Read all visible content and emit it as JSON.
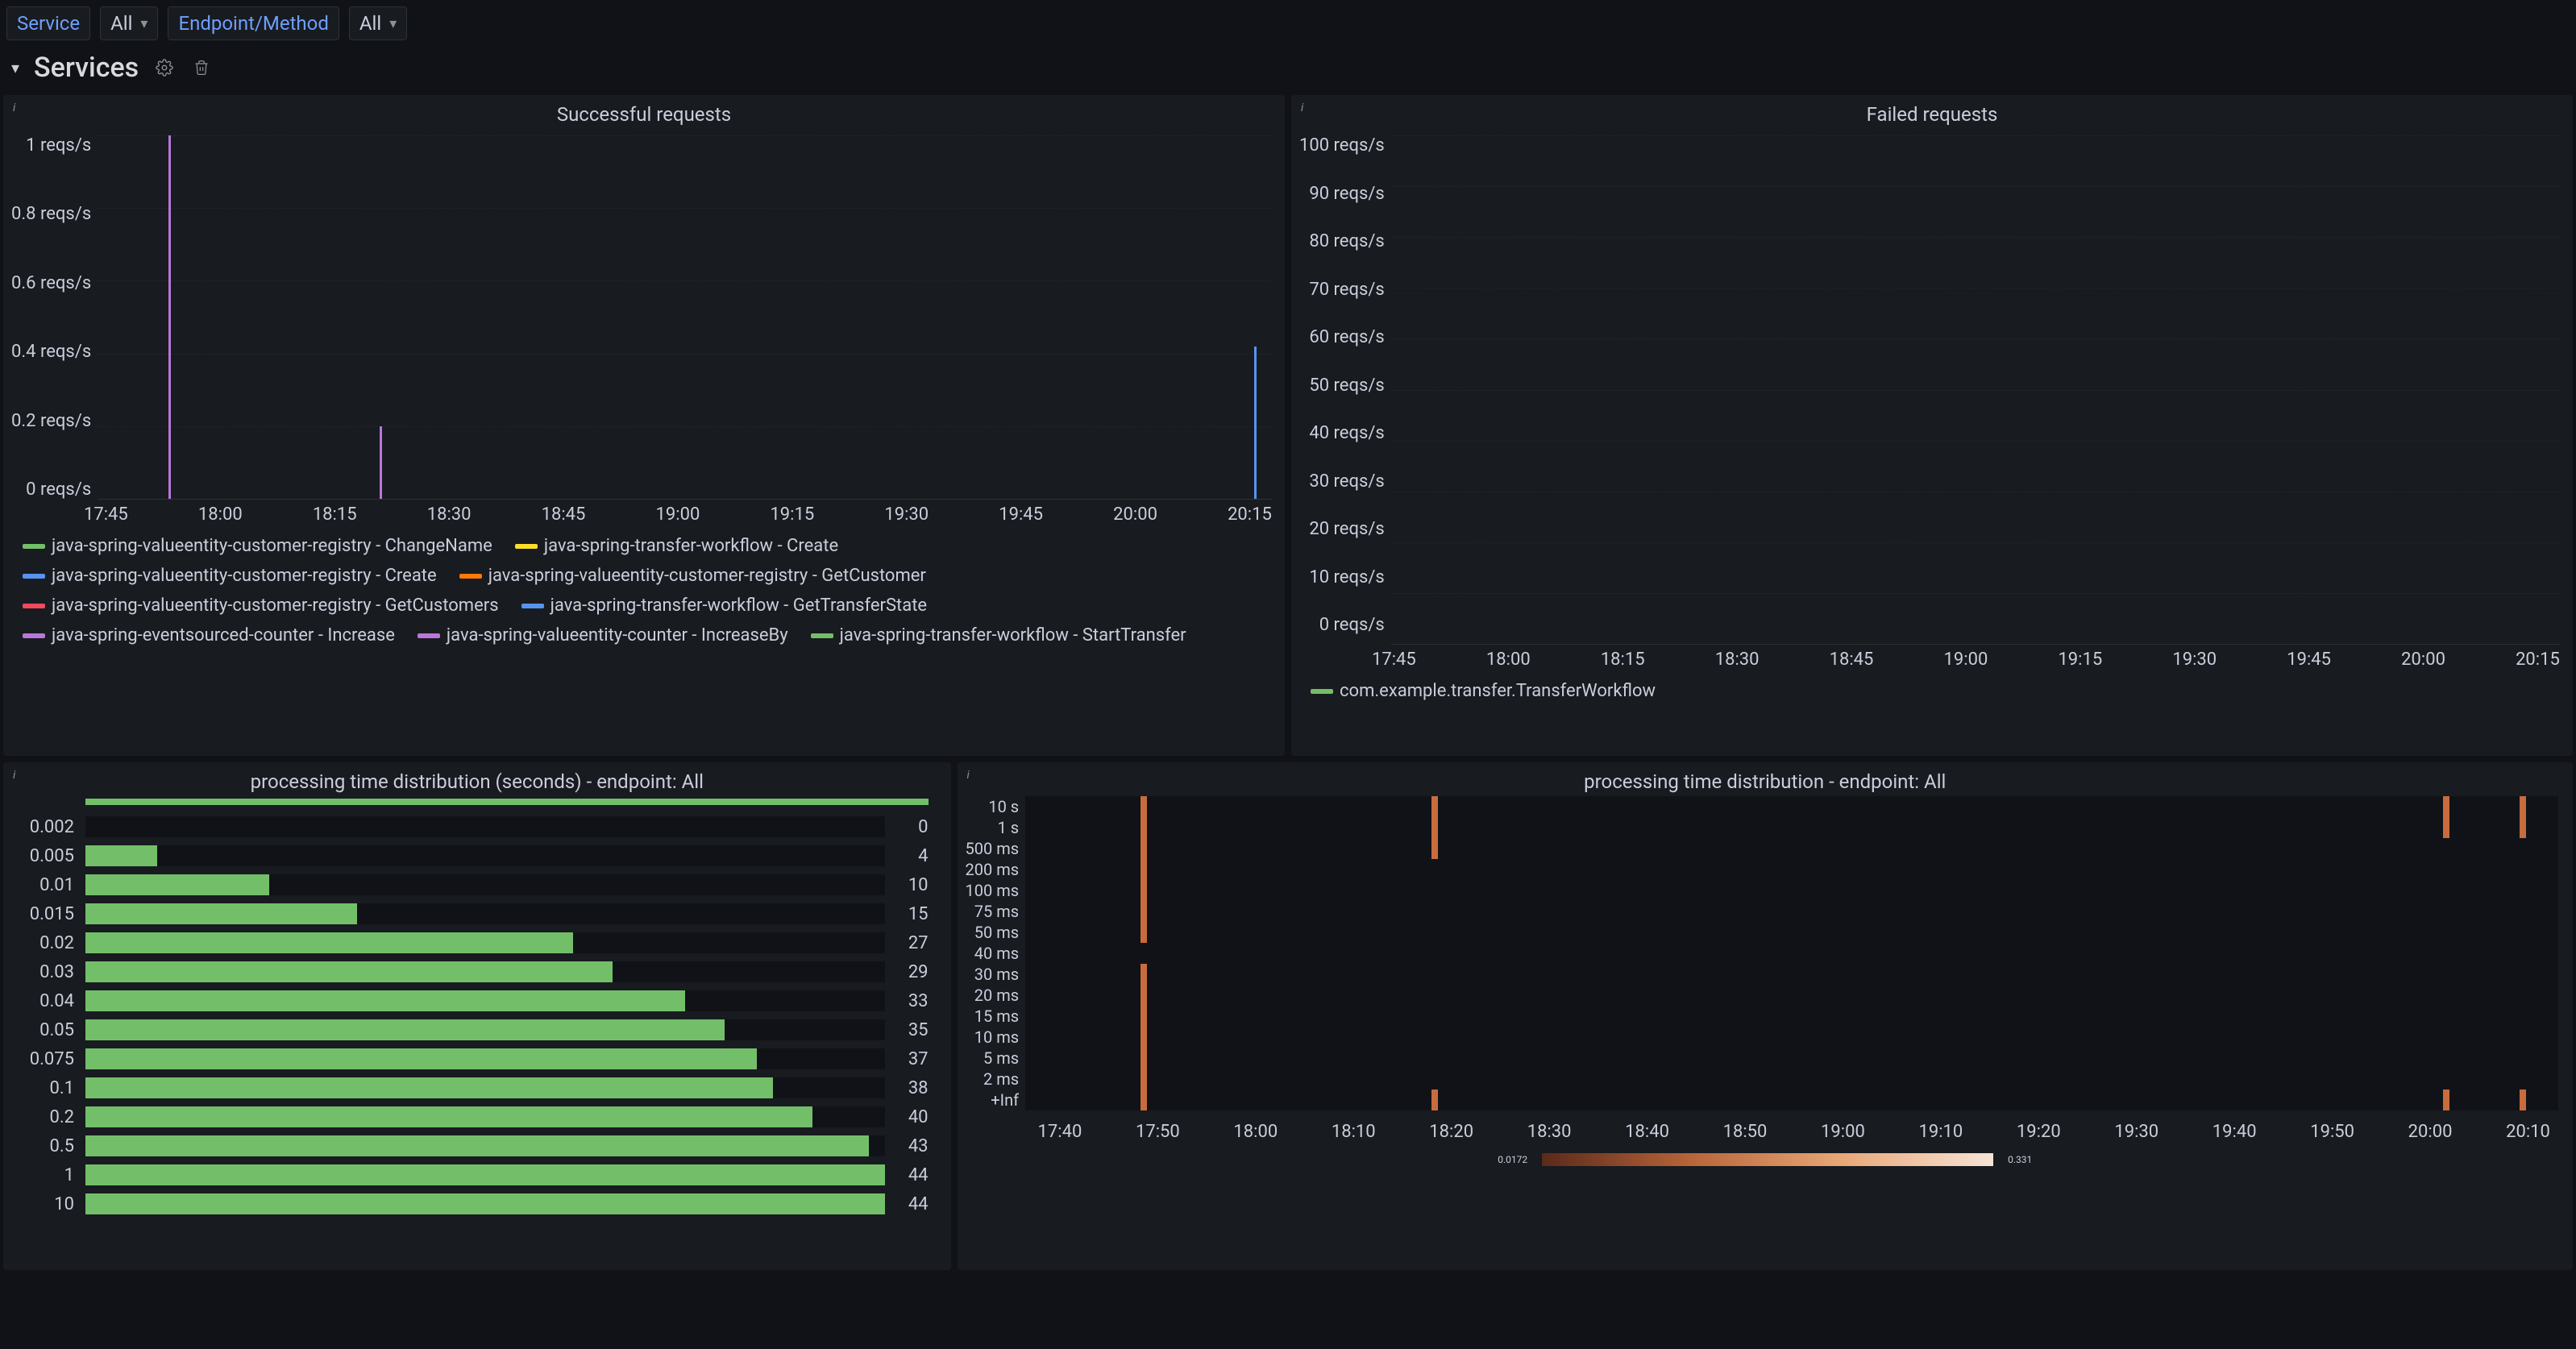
{
  "toolbar": {
    "service_label": "Service",
    "service_value": "All",
    "endpoint_label": "Endpoint/Method",
    "endpoint_value": "All"
  },
  "section_title": "Services",
  "panel_successful": {
    "title": "Successful requests",
    "y_ticks": [
      "1 reqs/s",
      "0.8 reqs/s",
      "0.6 reqs/s",
      "0.4 reqs/s",
      "0.2 reqs/s",
      "0 reqs/s"
    ],
    "x_ticks": [
      "17:45",
      "18:00",
      "18:15",
      "18:30",
      "18:45",
      "19:00",
      "19:15",
      "19:30",
      "19:45",
      "20:00",
      "20:15"
    ],
    "legend": [
      {
        "color": "#73bf69",
        "label": "java-spring-valueentity-customer-registry - ChangeName"
      },
      {
        "color": "#fade2a",
        "label": "java-spring-transfer-workflow - Create"
      },
      {
        "color": "#5794f2",
        "label": "java-spring-valueentity-customer-registry - Create"
      },
      {
        "color": "#ff780a",
        "label": "java-spring-valueentity-customer-registry - GetCustomer"
      },
      {
        "color": "#f2495c",
        "label": "java-spring-valueentity-customer-registry - GetCustomers"
      },
      {
        "color": "#5794f2",
        "label": "java-spring-transfer-workflow - GetTransferState"
      },
      {
        "color": "#b877d9",
        "label": "java-spring-eventsourced-counter - Increase"
      },
      {
        "color": "#b877d9",
        "label": "java-spring-valueentity-counter - IncreaseBy"
      },
      {
        "color": "#73bf69",
        "label": "java-spring-transfer-workflow - StartTransfer"
      }
    ]
  },
  "panel_failed": {
    "title": "Failed requests",
    "y_ticks": [
      "100 reqs/s",
      "90 reqs/s",
      "80 reqs/s",
      "70 reqs/s",
      "60 reqs/s",
      "50 reqs/s",
      "40 reqs/s",
      "30 reqs/s",
      "20 reqs/s",
      "10 reqs/s",
      "0 reqs/s"
    ],
    "x_ticks": [
      "17:45",
      "18:00",
      "18:15",
      "18:30",
      "18:45",
      "19:00",
      "19:15",
      "19:30",
      "19:45",
      "20:00",
      "20:15"
    ],
    "legend": [
      {
        "color": "#73bf69",
        "label": "com.example.transfer.TransferWorkflow"
      }
    ]
  },
  "panel_hist": {
    "title": "processing time distribution (seconds) - endpoint: All",
    "rows": [
      {
        "bucket": "0.002",
        "count": 0,
        "frac": 0.0
      },
      {
        "bucket": "0.005",
        "count": 4,
        "frac": 0.09
      },
      {
        "bucket": "0.01",
        "count": 10,
        "frac": 0.23
      },
      {
        "bucket": "0.015",
        "count": 15,
        "frac": 0.34
      },
      {
        "bucket": "0.02",
        "count": 27,
        "frac": 0.61
      },
      {
        "bucket": "0.03",
        "count": 29,
        "frac": 0.66
      },
      {
        "bucket": "0.04",
        "count": 33,
        "frac": 0.75
      },
      {
        "bucket": "0.05",
        "count": 35,
        "frac": 0.8
      },
      {
        "bucket": "0.075",
        "count": 37,
        "frac": 0.84
      },
      {
        "bucket": "0.1",
        "count": 38,
        "frac": 0.86
      },
      {
        "bucket": "0.2",
        "count": 40,
        "frac": 0.91
      },
      {
        "bucket": "0.5",
        "count": 43,
        "frac": 0.98
      },
      {
        "bucket": "1",
        "count": 44,
        "frac": 1.0
      },
      {
        "bucket": "10",
        "count": 44,
        "frac": 1.0
      }
    ]
  },
  "panel_heat": {
    "title": "processing time distribution - endpoint: All",
    "y_ticks": [
      "10 s",
      "1 s",
      "500 ms",
      "200 ms",
      "100 ms",
      "75 ms",
      "50 ms",
      "40 ms",
      "30 ms",
      "20 ms",
      "15 ms",
      "10 ms",
      "5 ms",
      "2 ms",
      "+Inf"
    ],
    "x_ticks": [
      "17:40",
      "17:50",
      "18:00",
      "18:10",
      "18:20",
      "18:30",
      "18:40",
      "18:50",
      "19:00",
      "19:10",
      "19:20",
      "19:30",
      "19:40",
      "19:50",
      "20:00",
      "20:10"
    ],
    "scale_min": "0.0172",
    "scale_max": "0.331",
    "columns": [
      {
        "x_frac": 0.075,
        "cells": [
          1,
          1,
          1,
          1,
          1,
          1,
          1,
          0,
          1,
          1,
          1,
          1,
          1,
          1,
          1
        ]
      },
      {
        "x_frac": 0.265,
        "cells": [
          1,
          0,
          0,
          0,
          0,
          0,
          0,
          0,
          0,
          0,
          0,
          0,
          1,
          1,
          1
        ]
      },
      {
        "x_frac": 0.925,
        "cells": [
          1,
          0,
          0,
          0,
          0,
          0,
          0,
          0,
          0,
          0,
          0,
          0,
          0,
          1,
          1
        ]
      },
      {
        "x_frac": 0.975,
        "cells": [
          1,
          0,
          0,
          0,
          0,
          0,
          0,
          0,
          0,
          0,
          0,
          0,
          0,
          1,
          1
        ]
      }
    ]
  },
  "chart_data": [
    {
      "type": "line",
      "title": "Successful requests",
      "xlabel": "",
      "ylabel": "reqs/s",
      "ylim": [
        0,
        1
      ],
      "x": [
        "17:45",
        "18:00",
        "18:15",
        "18:30",
        "18:45",
        "19:00",
        "19:15",
        "19:30",
        "19:45",
        "20:00",
        "20:15"
      ],
      "series": [
        {
          "name": "java-spring-valueentity-customer-registry - ChangeName",
          "spikes": []
        },
        {
          "name": "java-spring-transfer-workflow - Create",
          "spikes": []
        },
        {
          "name": "java-spring-valueentity-customer-registry - Create",
          "spikes": [
            {
              "t": "20:17",
              "v": 0.42
            }
          ]
        },
        {
          "name": "java-spring-valueentity-customer-registry - GetCustomer",
          "spikes": []
        },
        {
          "name": "java-spring-valueentity-customer-registry - GetCustomers",
          "spikes": []
        },
        {
          "name": "java-spring-transfer-workflow - GetTransferState",
          "spikes": []
        },
        {
          "name": "java-spring-eventsourced-counter - Increase",
          "spikes": [
            {
              "t": "17:40",
              "v": 1.0
            }
          ]
        },
        {
          "name": "java-spring-valueentity-counter - IncreaseBy",
          "spikes": [
            {
              "t": "18:13",
              "v": 0.2
            }
          ]
        },
        {
          "name": "java-spring-transfer-workflow - StartTransfer",
          "spikes": []
        }
      ]
    },
    {
      "type": "line",
      "title": "Failed requests",
      "xlabel": "",
      "ylabel": "reqs/s",
      "ylim": [
        0,
        100
      ],
      "x": [
        "17:45",
        "18:00",
        "18:15",
        "18:30",
        "18:45",
        "19:00",
        "19:15",
        "19:30",
        "19:45",
        "20:00",
        "20:15"
      ],
      "series": [
        {
          "name": "com.example.transfer.TransferWorkflow",
          "values": [
            0,
            0,
            0,
            0,
            0,
            0,
            0,
            0,
            0,
            0,
            0
          ]
        }
      ]
    },
    {
      "type": "bar",
      "title": "processing time distribution (seconds) - endpoint: All",
      "categories": [
        "0.002",
        "0.005",
        "0.01",
        "0.015",
        "0.02",
        "0.03",
        "0.04",
        "0.05",
        "0.075",
        "0.1",
        "0.2",
        "0.5",
        "1",
        "10"
      ],
      "values": [
        0,
        4,
        10,
        15,
        27,
        29,
        33,
        35,
        37,
        38,
        40,
        43,
        44,
        44
      ],
      "xlabel": "count",
      "ylabel": "bucket (s)",
      "ylim": [
        0,
        44
      ]
    },
    {
      "type": "heatmap",
      "title": "processing time distribution - endpoint: All",
      "x": [
        "17:40",
        "17:50",
        "18:00",
        "18:10",
        "18:20",
        "18:30",
        "18:40",
        "18:50",
        "19:00",
        "19:10",
        "19:20",
        "19:30",
        "19:40",
        "19:50",
        "20:00",
        "20:10"
      ],
      "y": [
        "10 s",
        "1 s",
        "500 ms",
        "200 ms",
        "100 ms",
        "75 ms",
        "50 ms",
        "40 ms",
        "30 ms",
        "20 ms",
        "15 ms",
        "10 ms",
        "5 ms",
        "2 ms",
        "+Inf"
      ],
      "value_range": [
        0.0172,
        0.331
      ]
    }
  ]
}
